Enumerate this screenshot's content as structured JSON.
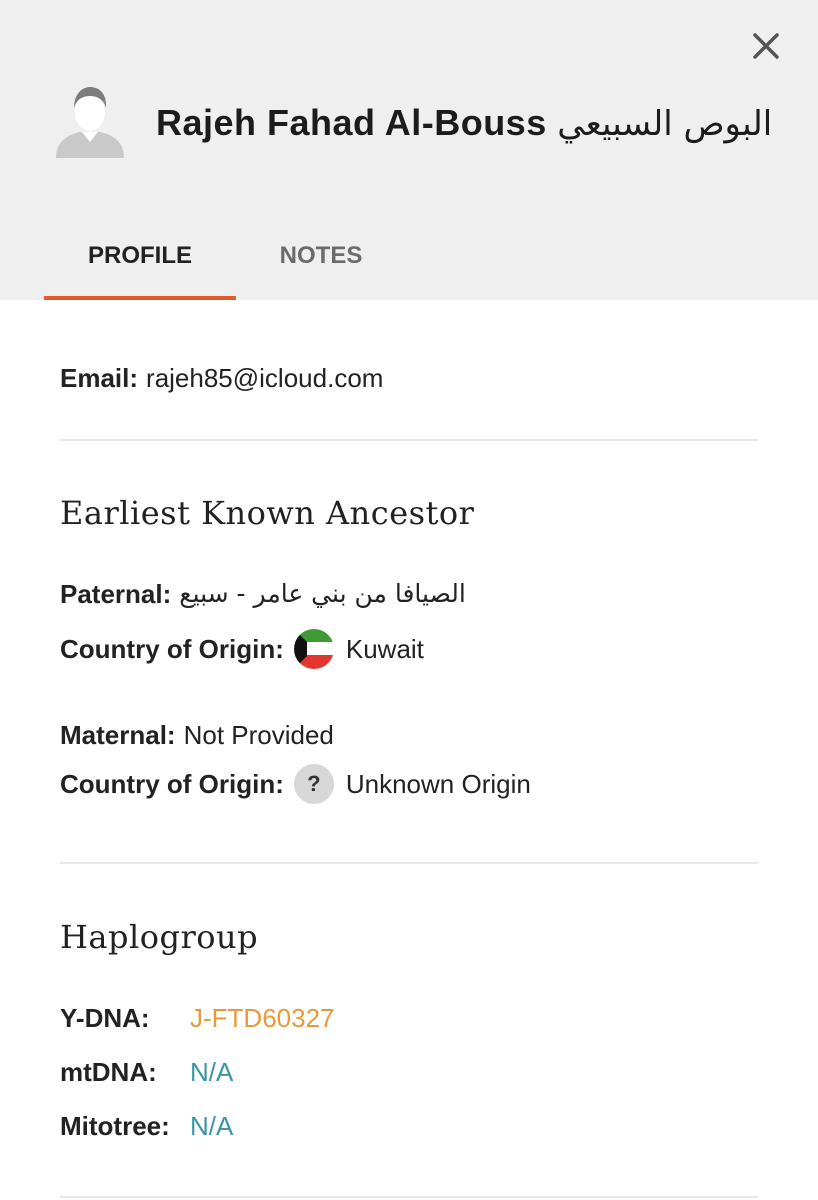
{
  "header": {
    "close_icon": "close-icon",
    "avatar_icon": "default-user-avatar-icon",
    "name_latin": "Rajeh Fahad Al-Bouss",
    "name_arabic": "البوص السبيعي"
  },
  "tabs": [
    {
      "label": "PROFILE",
      "active": true
    },
    {
      "label": "NOTES",
      "active": false
    }
  ],
  "accent_color": "#e05a2b",
  "profile": {
    "email_label": "Email:",
    "email_value": "rajeh85@icloud.com",
    "ancestor": {
      "section_title": "Earliest Known Ancestor",
      "paternal_label": "Paternal:",
      "paternal_value": "الصيافا من بني عامر - سبيع",
      "paternal_origin_label": "Country of Origin:",
      "paternal_origin_flag": "kuwait-flag-icon",
      "paternal_origin_value": "Kuwait",
      "maternal_label": "Maternal:",
      "maternal_value": "Not Provided",
      "maternal_origin_label": "Country of Origin:",
      "maternal_origin_icon": "question-mark-icon",
      "maternal_origin_icon_glyph": "?",
      "maternal_origin_value": "Unknown Origin"
    },
    "haplogroup": {
      "section_title": "Haplogroup",
      "rows": [
        {
          "label": "Y-DNA:",
          "value": "J-FTD60327",
          "color": "#e69a3c"
        },
        {
          "label": "mtDNA:",
          "value": "N/A",
          "color": "#3a96a6"
        },
        {
          "label": "Mitotree:",
          "value": "N/A",
          "color": "#3a96a6"
        }
      ]
    }
  }
}
